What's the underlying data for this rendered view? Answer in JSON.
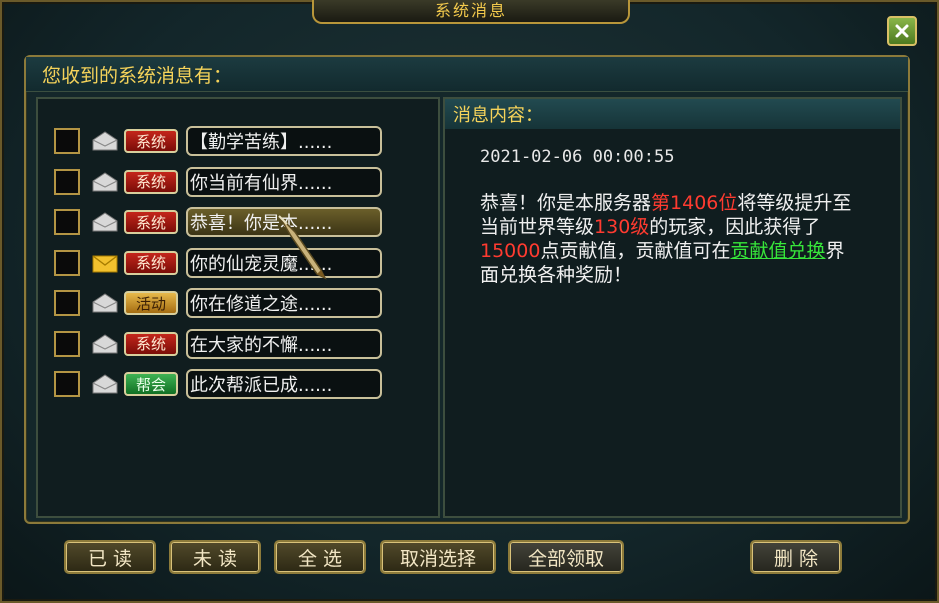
{
  "window": {
    "title": "系统消息"
  },
  "header": {
    "label": "您收到的系统消息有："
  },
  "messages": [
    {
      "tag": "系统",
      "tag_color": "red",
      "title": "【勤学苦练】......",
      "read": true,
      "selected": false
    },
    {
      "tag": "系统",
      "tag_color": "red",
      "title": "你当前有仙界......",
      "read": true,
      "selected": false
    },
    {
      "tag": "系统",
      "tag_color": "red",
      "title": "恭喜！你是本......",
      "read": true,
      "selected": true
    },
    {
      "tag": "系统",
      "tag_color": "red",
      "title": "你的仙宠灵魔......",
      "read": false,
      "selected": false
    },
    {
      "tag": "活动",
      "tag_color": "gold",
      "title": "你在修道之途......",
      "read": true,
      "selected": false
    },
    {
      "tag": "系统",
      "tag_color": "red",
      "title": "在大家的不懈......",
      "read": true,
      "selected": false
    },
    {
      "tag": "帮会",
      "tag_color": "green",
      "title": "此次帮派已成......",
      "read": true,
      "selected": false
    }
  ],
  "content": {
    "label": "消息内容：",
    "timestamp": "2021-02-06 00:00:55",
    "p1": "恭喜！你是本服务器",
    "rank": "第1406位",
    "p2": "将等级提升至当前世界等级",
    "level": "130级",
    "p3": "的玩家，因此获得了",
    "points": "15000",
    "p4": "点贡献值，贡献值可在",
    "link": "贡献值兑换",
    "p5": "界面兑换各种奖励！"
  },
  "buttons": {
    "mark_read": "已 读",
    "mark_unread": "未 读",
    "select_all": "全 选",
    "cancel_select": "取消选择",
    "claim_all": "全部领取",
    "delete": "删 除"
  },
  "colors": {
    "accent_gold": "#f5d35a",
    "highlight_red": "#ff3b30",
    "link_green": "#37e63a",
    "tag_red": "#c4261b",
    "tag_gold": "#e7b94a",
    "tag_green": "#3fb253"
  },
  "icons": {
    "read": "open-envelope-icon",
    "unread": "closed-envelope-icon",
    "close": "close-x-icon"
  }
}
